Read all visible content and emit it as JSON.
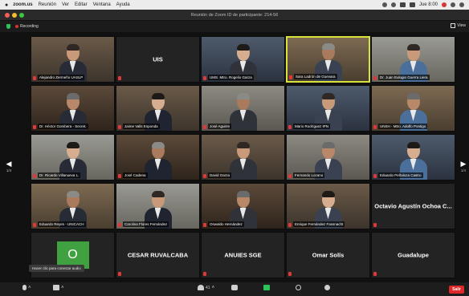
{
  "menubar": {
    "items": [
      "zoom.us",
      "Reunión",
      "Ver",
      "Editar",
      "Ventana",
      "Ayuda"
    ],
    "clock": "Jue 8:00"
  },
  "window": {
    "title": "Reunión de Zoom ID de participante: 214-56"
  },
  "zoom_top": {
    "recording_label": "Recording",
    "view_label": "View"
  },
  "tiles": [
    {
      "name": "Alejandro Zermeño UASLP",
      "type": "video"
    },
    {
      "name": "UIS",
      "type": "name-only"
    },
    {
      "name": "UMS. Mtro. Rogelio Garza",
      "type": "video"
    },
    {
      "name": "Sara Ladrón de Guevara",
      "type": "video",
      "active": true
    },
    {
      "name": "Dr. Juan Eulogio Guerra Liera",
      "type": "video"
    },
    {
      "name": "Dr. Héctor Gombera - Secret.",
      "type": "video"
    },
    {
      "name": "Jaime Valls Esponda",
      "type": "video"
    },
    {
      "name": "José Aguirre",
      "type": "video"
    },
    {
      "name": "Mario Rodríguez IPN",
      "type": "video"
    },
    {
      "name": "UNSH - Mtro. Adolfo Pontigo",
      "type": "video"
    },
    {
      "name": "Dr. Ricardo Villanueva L.",
      "type": "video"
    },
    {
      "name": "José Cadena",
      "type": "video"
    },
    {
      "name": "David Garza",
      "type": "video"
    },
    {
      "name": "Fernando Lozano",
      "type": "video"
    },
    {
      "name": "Eduardo Peñaloza Castro",
      "type": "video"
    },
    {
      "name": "Eduardo Reyes - UNICACH",
      "type": "video"
    },
    {
      "name": "Carolina Flores Fernández",
      "type": "video"
    },
    {
      "name": "Oswaldo Hernández",
      "type": "video"
    },
    {
      "name": "Enrique Fernández Fassnacht",
      "type": "video"
    },
    {
      "name": "Octavio Agustín Ochoa C...",
      "type": "name-only"
    },
    {
      "name": "O",
      "type": "avatar"
    },
    {
      "name": "CESAR RUVALCABA",
      "type": "name-only"
    },
    {
      "name": "ANUIES SGE",
      "type": "name-only"
    },
    {
      "name": "Omar Solís",
      "type": "name-only"
    },
    {
      "name": "Guadalupe",
      "type": "name-only"
    }
  ],
  "pager": {
    "left_page": "1/4",
    "right_page": "1/4"
  },
  "tooltip": "Hacer clic para conectar audio",
  "toolbar": {
    "participants_count": "41",
    "leave_label": "Salir"
  },
  "colors": {
    "active_speaker_border": "#d8e23a",
    "avatar_green": "#3fa13f",
    "leave_red": "#e02828"
  }
}
